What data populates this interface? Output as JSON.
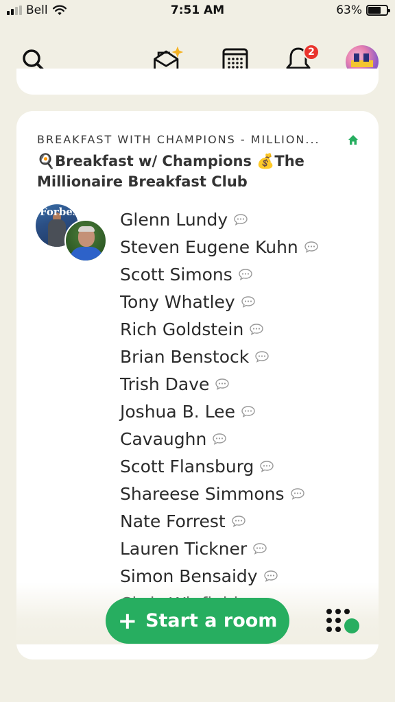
{
  "status_bar": {
    "carrier": "Bell",
    "time": "7:51 AM",
    "battery": "63%",
    "signal_bars_filled": 2
  },
  "nav": {
    "notifications_count": "2"
  },
  "room": {
    "club_name": "BREAKFAST WITH CHAMPIONS - MILLION...",
    "title_line1": "🍳Breakfast w/ Champions 💰The",
    "title_line2": "Millionaire Breakfast Club",
    "speaker_avatar_text": "Forbes",
    "speakers": [
      "Glenn Lundy",
      "Steven Eugene Kuhn",
      "Scott Simons",
      "Tony Whatley",
      "Rich Goldstein",
      "Brian Benstock",
      "Trish Dave",
      "Joshua B. Lee",
      "Cavaughn",
      "Scott Flansburg",
      "Shareese Simmons",
      "Nate Forrest",
      "Lauren Tickner",
      "Simon Bensaidy",
      "Chris Winfield"
    ]
  },
  "actions": {
    "start_room": "Start a room"
  },
  "colors": {
    "accent_green": "#27ae60",
    "badge_red": "#e9342d",
    "background": "#f1efe4"
  }
}
